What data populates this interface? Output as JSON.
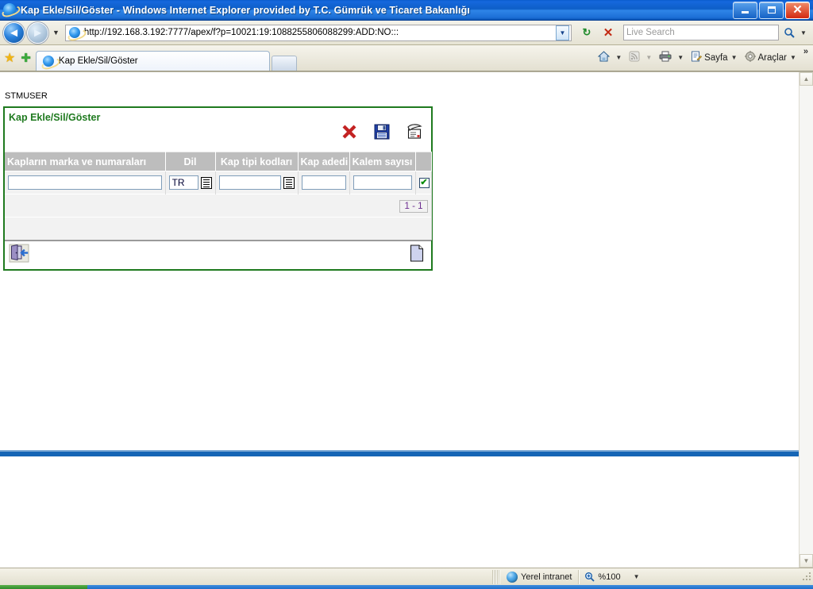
{
  "window": {
    "title": "Kap Ekle/Sil/Göster - Windows Internet Explorer provided by T.C. Gümrük ve Ticaret Bakanlığı",
    "minimize_label": "",
    "maximize_label": "",
    "close_label": "✕"
  },
  "addressbar": {
    "back_glyph": "◄",
    "forward_glyph": "►",
    "history_glyph": "▼",
    "url": "http://192.168.3.192:7777/apex/f?p=10021:19:1088255806088299:ADD:NO:::",
    "url_dropdown_glyph": "▼",
    "refresh_glyph": "↻",
    "stop_glyph": "✕",
    "search_placeholder": "Live Search",
    "search_value": "",
    "search_go_glyph": "🔍",
    "search_options_glyph": "▼"
  },
  "tabbar": {
    "favorites_star_glyph": "★",
    "add_favorites_glyph": "✚",
    "tab_label": "Kap Ekle/Sil/Göster",
    "new_tab_label": "",
    "commands": [
      {
        "name": "home",
        "label": "",
        "icon": "🏠",
        "has_caret": true
      },
      {
        "name": "feeds",
        "label": "",
        "icon": "📶",
        "has_caret": true
      },
      {
        "name": "print",
        "label": "",
        "icon": "🖶",
        "has_caret": true
      },
      {
        "name": "page",
        "label": "Sayfa",
        "icon": "📝",
        "has_caret": true
      },
      {
        "name": "tools",
        "label": "Araçlar",
        "icon": "⚙",
        "has_caret": true
      }
    ],
    "overflow_glyph": "»"
  },
  "page": {
    "breadcrumb_user": "STMUSER",
    "region": {
      "title": "Kap Ekle/Sil/Göster",
      "tools": [
        {
          "name": "cancel",
          "glyph": "✕",
          "title": "Cancel"
        },
        {
          "name": "save",
          "glyph": "💾",
          "title": "Save"
        },
        {
          "name": "create",
          "glyph": "🗒",
          "title": "Create"
        }
      ],
      "columns": [
        "Kapların marka ve numaraları",
        "Dil",
        "Kap tipi kodları",
        "Kap adedi",
        "Kalem sayısı",
        ""
      ],
      "rows": [
        {
          "marka_numaralari": "",
          "dil": "TR",
          "kap_tipi_kodlari": "",
          "kap_adedi": "",
          "kalem_sayisi": "",
          "selected": true,
          "check_glyph": "✔"
        }
      ],
      "pagination": "1 - 1",
      "footer_buttons": [
        {
          "name": "back",
          "label": "",
          "title": "Geri"
        },
        {
          "name": "add-row",
          "label": "",
          "title": "Ekle"
        }
      ]
    }
  },
  "statusbar": {
    "zone_label": "Yerel intranet",
    "zoom_label": "%100",
    "zoom_dropdown_glyph": "▼"
  },
  "colors": {
    "title_bar_blue": "#1668dd",
    "region_green": "#1f7a1f",
    "header_gray": "#bdbdbd",
    "pagination_purple": "#6b2c8f",
    "separator_blue": "#1565b5"
  },
  "scrollbar": {
    "up_glyph": "▲",
    "down_glyph": "▼"
  }
}
